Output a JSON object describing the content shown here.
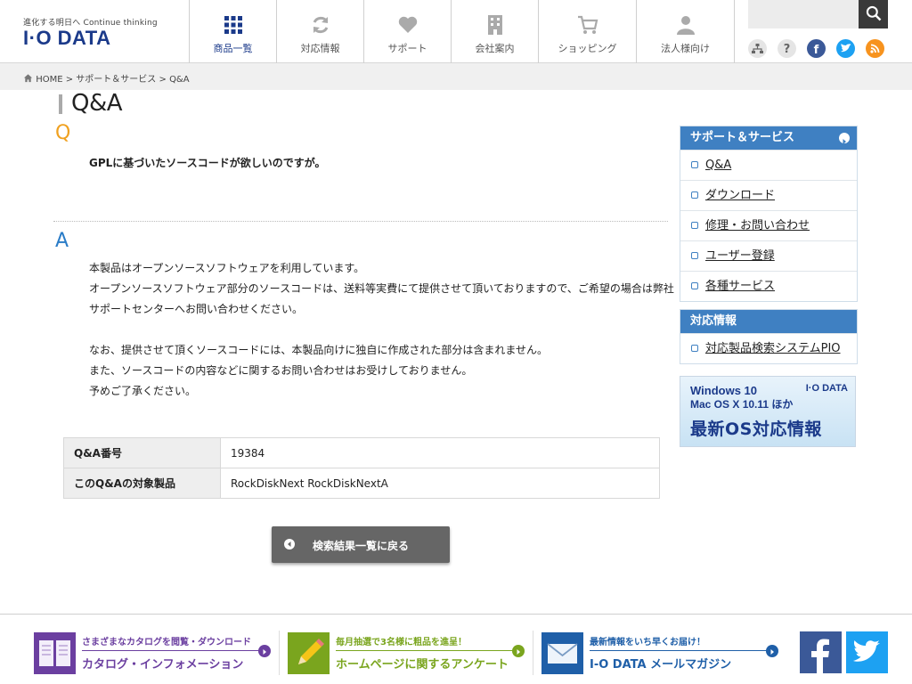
{
  "header": {
    "logo_tagline": "進化する明日へ Continue thinking",
    "logo_name": "I·O DATA",
    "nav": [
      {
        "label": "商品一覧",
        "icon": "grid-icon",
        "active": true
      },
      {
        "label": "対応情報",
        "icon": "refresh-icon"
      },
      {
        "label": "サポート",
        "icon": "heart-icon"
      },
      {
        "label": "会社案内",
        "icon": "building-icon"
      },
      {
        "label": "ショッピング",
        "icon": "cart-icon"
      },
      {
        "label": "法人様向け",
        "icon": "person-icon"
      }
    ],
    "search_placeholder": "",
    "utility_icons": [
      "sitemap-icon",
      "help-icon",
      "facebook-icon",
      "twitter-icon",
      "rss-icon"
    ]
  },
  "breadcrumb": {
    "items": [
      "HOME",
      "サポート＆サービス",
      "Q&A"
    ],
    "separator": ">"
  },
  "main": {
    "title": "Q&A",
    "q_mark": "Q",
    "a_mark": "A",
    "question": "GPLに基づいたソースコードが欲しいのですが。",
    "answer_lines": [
      "本製品はオープンソースソフトウェアを利用しています。",
      "オープンソースソフトウェア部分のソースコードは、送料等実費にて提供させて頂いておりますので、ご希望の場合は弊社",
      "サポートセンターへお問い合わせください。",
      "",
      "なお、提供させて頂くソースコードには、本製品向けに独自に作成された部分は含まれません。",
      "また、ソースコードの内容などに関するお問い合わせはお受けしておりません。",
      "予めご了承ください。"
    ],
    "table": [
      {
        "key": "Q&A番号",
        "value": "19384"
      },
      {
        "key": "このQ&Aの対象製品",
        "value": "RockDiskNext RockDiskNextA"
      }
    ],
    "back_button": "検索結果一覧に戻る"
  },
  "sidebar": {
    "support": {
      "title": "サポート＆サービス",
      "items": [
        "Q&A",
        "ダウンロード",
        "修理・お問い合わせ",
        "ユーザー登録",
        "各種サービス"
      ]
    },
    "compat": {
      "title": "対応情報",
      "items": [
        "対応製品検索システムPIO"
      ]
    },
    "os_banner": {
      "line1": "Windows 10",
      "line2": "Mac OS X 10.11 ほか",
      "line3": "最新OS対応情報",
      "logo": "I·O DATA"
    }
  },
  "footer": {
    "banners": [
      {
        "top": "さまざまなカタログを閲覧・ダウンロード",
        "main": "カタログ・インフォメーション",
        "color": "#6b3fa0"
      },
      {
        "top": "毎月抽選で3名様に粗品を進呈！",
        "main": "ホームページに関するアンケート",
        "color": "#7aa51e"
      },
      {
        "top": "最新情報をいち早くお届け！",
        "main": "I-O DATA メールマガジン",
        "color": "#1f5fa8"
      }
    ],
    "social": [
      "facebook-icon",
      "twitter-icon"
    ]
  },
  "colors": {
    "brand": "#1b3a8a",
    "accent_blue": "#3f80c2",
    "q_orange": "#f0a120",
    "a_blue": "#2a7cc7"
  }
}
